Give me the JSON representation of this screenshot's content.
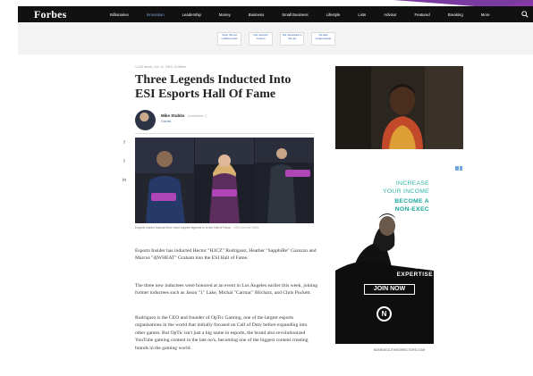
{
  "brand": {
    "logo": "Forbes"
  },
  "nav": {
    "items": [
      {
        "label": "Billionaires",
        "active": false
      },
      {
        "label": "Innovation",
        "active": true
      },
      {
        "label": "Leadership",
        "active": false
      },
      {
        "label": "Money",
        "active": false
      },
      {
        "label": "Business",
        "active": false
      },
      {
        "label": "Small Business",
        "active": false
      },
      {
        "label": "Lifestyle",
        "active": false
      },
      {
        "label": "Lists",
        "active": false
      },
      {
        "label": "Advisor",
        "active": false
      },
      {
        "label": "Featured",
        "active": false
      },
      {
        "label": "Breaking",
        "active": false
      },
      {
        "label": "More",
        "active": false
      }
    ],
    "search_icon": "search-icon"
  },
  "ad_feedback": {
    "options": [
      "Seen this ad multiple times",
      "Not relevant content",
      "Not interested in this ad",
      "Ad was inappropriate"
    ]
  },
  "article": {
    "meta": "1,225 views  |  Jun 12, 2019, 10:59am",
    "title": "Three Legends Inducted Into ESI Esports Hall Of Fame",
    "author": {
      "name": "Mike Stubbs",
      "role": "Contributor ⓘ",
      "section": "Games"
    },
    "share": [
      "f",
      "t",
      "in"
    ],
    "photo_caption": "Esports Insider inducts three more esports legends in to the Hall of Fame.",
    "photo_credit": "ESI/Lemonte Wells",
    "paragraphs": [
      "Esports Insider has inducted Hector \"H3CZ\" Rodriguez, Heather \"SapphiRe\" Garozzo and Marcus \"djWHEAT\" Graham into the ESI Hall of Fame.",
      "The three new inductees were honored at an event in Los Angeles earlier this week, joining former inductees such as Jason \"1\" Lake, Michal \"Carmac\" Blicharz, and Chris Puckett.",
      "Rodriguez is the CEO and founder of OpTic Gaming, one of the largest esports organisations in the world that initially focused on Call of Duty before expanding into other games. But OpTic isn't just a big name in esports, the brand also revolutionized YouTube gaming content in the late oo's, becoming one of the biggest content creating brands in the gaming world."
    ]
  },
  "ad": {
    "lines": [
      "INCREASE",
      "YOUR INCOME",
      "BECOME A",
      "NON-EXEC"
    ],
    "share_lines": [
      "SHARE",
      "YOUR",
      "EXPERTISE"
    ],
    "cta": "JOIN NOW",
    "logo_letter": "N",
    "footer": "NONEXECUTIVEDIRECTORS.COM"
  }
}
